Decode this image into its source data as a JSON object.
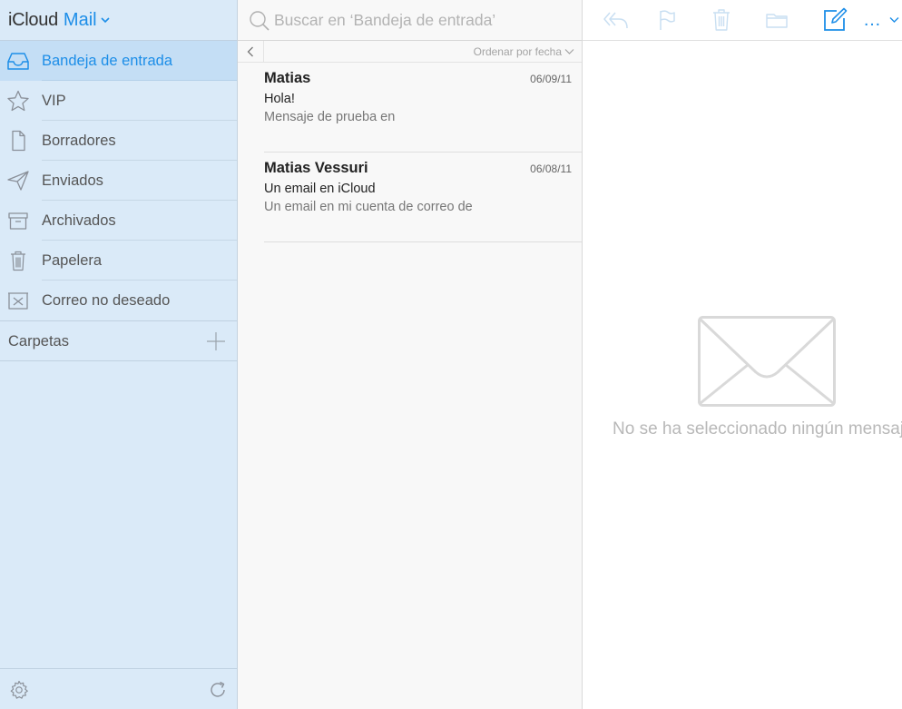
{
  "app": {
    "brand": "iCloud",
    "product": "Mail"
  },
  "sidebar": {
    "items": [
      {
        "label": "Bandeja de entrada",
        "icon": "inbox-icon",
        "active": true
      },
      {
        "label": "VIP",
        "icon": "star-icon"
      },
      {
        "label": "Borradores",
        "icon": "document-icon"
      },
      {
        "label": "Enviados",
        "icon": "paper-plane-icon"
      },
      {
        "label": "Archivados",
        "icon": "archive-box-icon"
      },
      {
        "label": "Papelera",
        "icon": "trash-icon"
      },
      {
        "label": "Correo no deseado",
        "icon": "junk-box-icon"
      }
    ],
    "folders_label": "Carpetas"
  },
  "search": {
    "placeholder": "Buscar en ‘Bandeja de entrada’"
  },
  "list": {
    "sort_label": "Ordenar por fecha",
    "messages": [
      {
        "sender": "Matias",
        "date": "06/09/11",
        "subject": "Hola!",
        "preview": "Mensaje de prueba en"
      },
      {
        "sender": "Matias Vessuri",
        "date": "06/08/11",
        "subject": "Un email en iCloud",
        "preview": "Un email en mi cuenta de correo de"
      }
    ]
  },
  "toolbar": {
    "more_label": "…"
  },
  "reading": {
    "empty_text": "No se ha seleccionado ningún mensaje"
  },
  "colors": {
    "accent": "#1d8ee8",
    "sidebar_bg": "#daeaf8",
    "sidebar_active": "#c4def5",
    "disabled_icon": "#c9dff2"
  }
}
